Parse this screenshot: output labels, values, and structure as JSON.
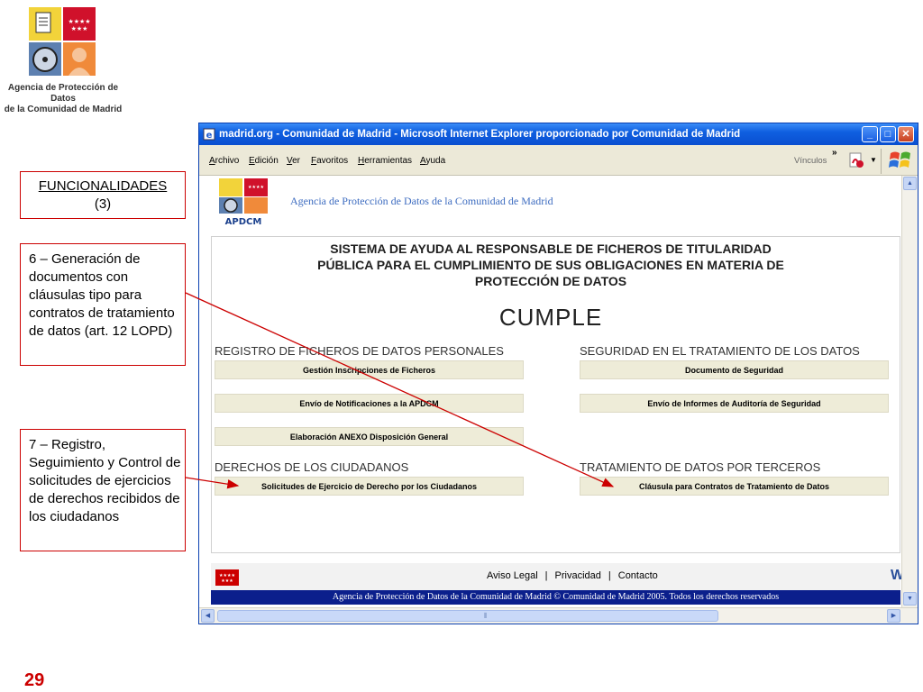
{
  "slide": {
    "logo_caption_line1": "Agencia de Protección de Datos",
    "logo_caption_line2": "de la Comunidad de Madrid",
    "slide_number": "29",
    "callout_title_line1": "FUNCIONALIDADES",
    "callout_title_line2": "(3)",
    "callout_6": "6 – Generación de documentos con cláusulas tipo para contratos de tratamiento de datos (art. 12 LOPD)",
    "callout_7": "7 – Registro, Seguimiento y Control de solicitudes de ejercicios de derechos recibidos de los ciudadanos"
  },
  "browser": {
    "title": "madrid.org - Comunidad de Madrid - Microsoft Internet Explorer proporcionado por Comunidad de Madrid",
    "menu": [
      "Archivo",
      "Edición",
      "Ver",
      "Favoritos",
      "Herramientas",
      "Ayuda"
    ],
    "links_label": "Vínculos",
    "chevron": "»"
  },
  "page": {
    "logo_text": "APDCM",
    "header_text": "Agencia de Protección de Datos de la Comunidad de Madrid",
    "system_title_line1": "SISTEMA DE AYUDA AL RESPONSABLE DE FICHEROS DE TITULARIDAD",
    "system_title_line2": "PÚBLICA PARA EL CUMPLIMIENTO DE SUS OBLIGACIONES EN MATERIA DE",
    "system_title_line3": "PROTECCIÓN DE DATOS",
    "cumple": "CUMPLE",
    "sections": {
      "registro": {
        "heading": "REGISTRO DE FICHEROS DE DATOS PERSONALES",
        "buttons": [
          "Gestión Inscripciones de Ficheros",
          "Envío de Notificaciones a la APDCM",
          "Elaboración ANEXO Disposición General"
        ]
      },
      "seguridad": {
        "heading": "SEGURIDAD EN EL TRATAMIENTO DE LOS DATOS",
        "buttons": [
          "Documento de Seguridad",
          "Envío de Informes de Auditoría de Seguridad"
        ]
      },
      "derechos": {
        "heading": "DERECHOS DE LOS CIUDADANOS",
        "buttons": [
          "Solicitudes de Ejercicio de Derecho por los Ciudadanos"
        ]
      },
      "terceros": {
        "heading": "TRATAMIENTO DE DATOS POR TERCEROS",
        "buttons": [
          "Cláusula para Contratos de Tratamiento de Datos"
        ]
      }
    },
    "footer": {
      "aviso": "Aviso Legal",
      "privacidad": "Privacidad",
      "contacto": "Contacto",
      "divider": "|",
      "w_glyph": "W",
      "copyright": "Agencia de Protección de Datos de la Comunidad de Madrid © Comunidad de Madrid 2005. Todos los derechos reservados"
    }
  },
  "colors": {
    "callout_border": "#cc0000",
    "arrow": "#cc0000",
    "titlebar": "#0f5fe0",
    "copyright_bar": "#0b1f8c",
    "action_button": "#eeecd8",
    "header_text": "#3d6cc0"
  }
}
